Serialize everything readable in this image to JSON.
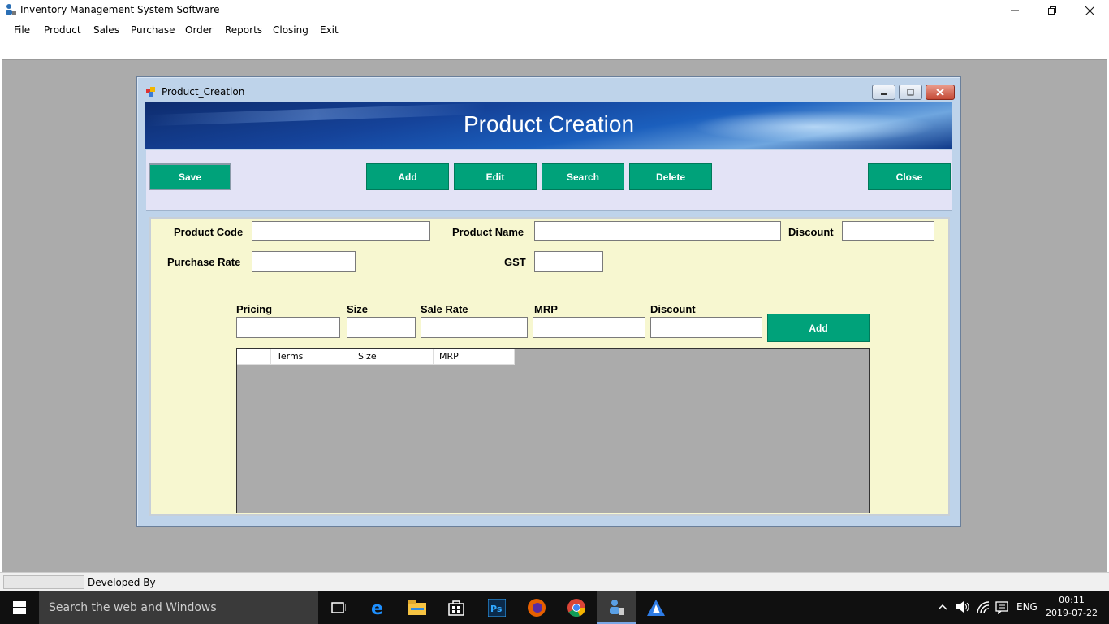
{
  "window": {
    "title": "Inventory Management System Software"
  },
  "menu": [
    "File",
    "Product",
    "Sales",
    "Purchase",
    "Order",
    "Reports",
    "Closing",
    "Exit"
  ],
  "child_form": {
    "title": "Product_Creation",
    "banner_title": "Product Creation"
  },
  "toolbar": {
    "save": "Save",
    "add": "Add",
    "edit": "Edit",
    "search": "Search",
    "delete": "Delete",
    "close": "Close"
  },
  "fields": {
    "product_code": {
      "label": "Product Code",
      "value": ""
    },
    "product_name": {
      "label": "Product Name",
      "value": ""
    },
    "discount": {
      "label": "Discount",
      "value": ""
    },
    "purchase_rate": {
      "label": "Purchase Rate",
      "value": ""
    },
    "gst": {
      "label": "GST",
      "value": ""
    }
  },
  "pricing": {
    "labels": {
      "pricing": "Pricing",
      "size": "Size",
      "sale_rate": "Sale Rate",
      "mrp": "MRP",
      "discount": "Discount"
    },
    "add_label": "Add"
  },
  "grid": {
    "columns": [
      "",
      "Terms",
      "Size",
      "MRP"
    ],
    "rows": []
  },
  "statusbar": {
    "text": "Developed By"
  },
  "taskbar": {
    "search_placeholder": "Search the web and Windows",
    "language": "ENG",
    "time": "00:11",
    "date": "2019-07-22"
  },
  "colors": {
    "action_green": "#00a27a",
    "panel_yellow": "#f7f7d0",
    "toolbar_lavender": "#e3e3f6",
    "workspace_gray": "#ababab"
  }
}
